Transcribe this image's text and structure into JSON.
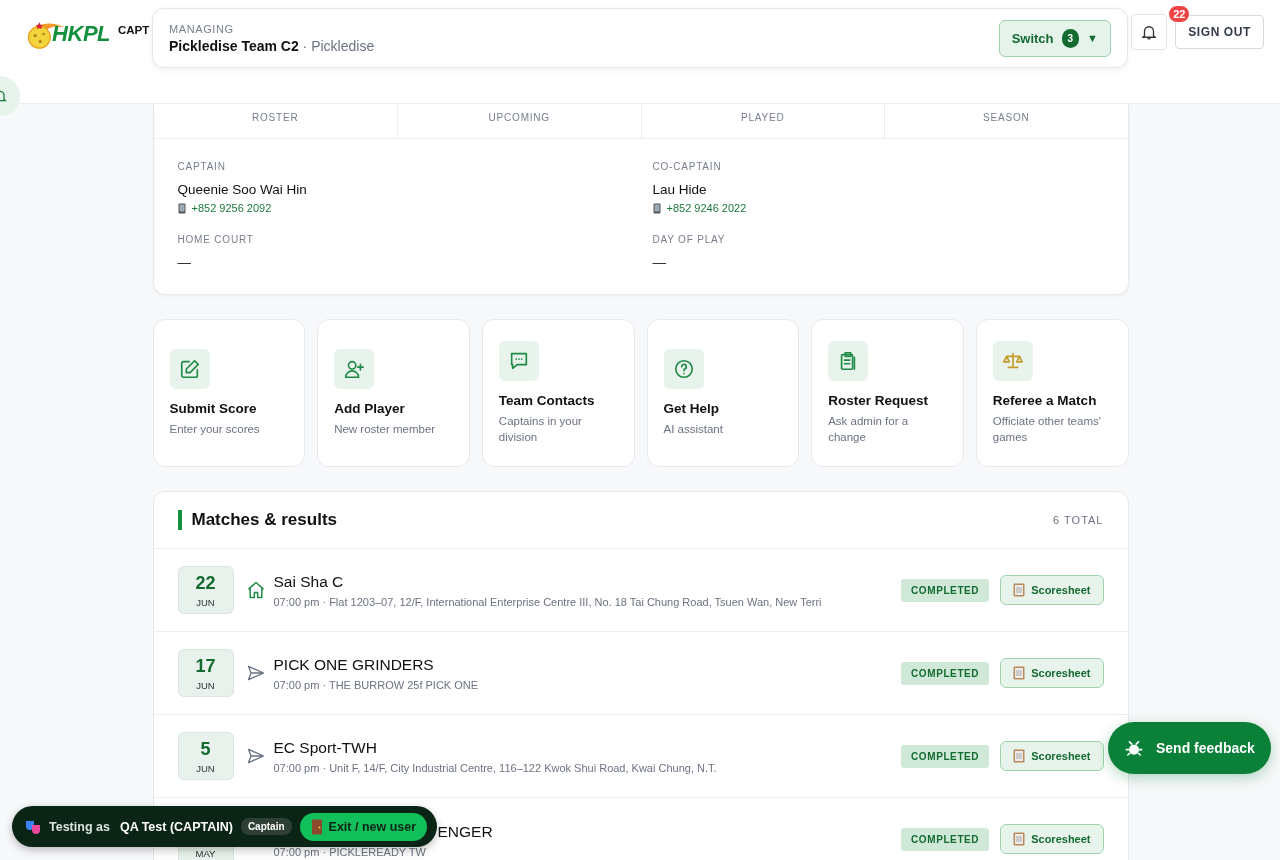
{
  "header": {
    "logo_text": "HKPL",
    "role_label": "CAPT",
    "notifications": "22",
    "sign_out": "SIGN OUT"
  },
  "managing": {
    "label": "MANAGING",
    "team": "Pickledise Team C2",
    "club": "· Pickledise",
    "switch": "Switch",
    "count": "3",
    "caret": "▼"
  },
  "stats_tabs": [
    "ROSTER",
    "UPCOMING",
    "PLAYED",
    "SEASON"
  ],
  "contacts": [
    {
      "label": "CAPTAIN",
      "name": "Queenie Soo Wai Hin",
      "phone": "+852 9256 2092"
    },
    {
      "label": "CO-CAPTAIN",
      "name": "Lau Hide",
      "phone": "+852 9246 2022"
    },
    {
      "label": "HOME COURT",
      "name": "—"
    },
    {
      "label": "DAY OF PLAY",
      "name": "—"
    }
  ],
  "actions": [
    {
      "kind": "edit",
      "title": "Submit Score",
      "subtitle": "Enter your scores"
    },
    {
      "kind": "add_user",
      "title": "Add Player",
      "subtitle": "New roster member"
    },
    {
      "kind": "chat",
      "title": "Team Contacts",
      "subtitle": "Captains in your division"
    },
    {
      "kind": "help",
      "title": "Get Help",
      "subtitle": "AI assistant"
    },
    {
      "kind": "clipboard",
      "title": "Roster Request",
      "subtitle": "Ask admin for a change"
    },
    {
      "kind": "scales",
      "title": "Referee a Match",
      "subtitle": "Officiate other teams' games"
    }
  ],
  "matches": {
    "title": "Matches & results",
    "total": "6 TOTAL",
    "rows": [
      {
        "kind": "home",
        "day": "22",
        "month": "JUN",
        "title": "Sai Sha C",
        "details": "07:00 pm · Flat 1203–07, 12/F, International Enterprise Centre III, No. 18 Tai Chung Road, Tsuen Wan, New Terri",
        "status": "COMPLETED",
        "action": "Scoresheet"
      },
      {
        "kind": "away",
        "day": "17",
        "month": "JUN",
        "title": "PICK ONE GRINDERS",
        "details": "07:00 pm · THE BURROW 25f PICK ONE",
        "status": "COMPLETED",
        "action": "Scoresheet"
      },
      {
        "kind": "away",
        "day": "5",
        "month": "JUN",
        "title": "EC Sport-TWH",
        "details": "07:00 pm · Unit F, 14/F, City Industrial Centre, 116–122 Kwok Shui Road, Kwai Chung, N.T.",
        "status": "COMPLETED",
        "action": "Scoresheet"
      },
      {
        "kind": "covered",
        "month": "MAY",
        "title": "ENGER",
        "details": "07:00 pm · PICKLEREADY TW",
        "status": "COMPLETED",
        "action": "Scoresheet"
      }
    ]
  },
  "testing_bar": {
    "label": "Testing as",
    "user": "QA Test (CAPTAIN)",
    "role": "Captain",
    "exit": "Exit / new user"
  },
  "feedback": "Send feedback"
}
